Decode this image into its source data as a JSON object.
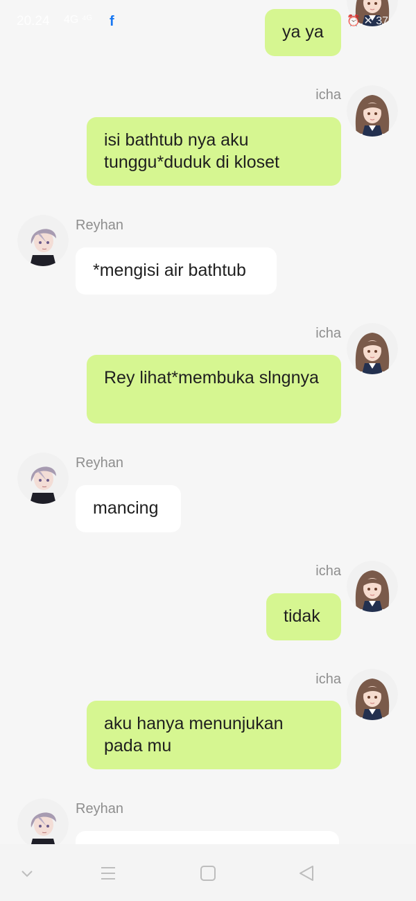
{
  "status_bar": {
    "time": "20.24",
    "signal": "4G ⁴ᴳ",
    "app_icon": "facebook-icon",
    "right": "⏰ ✕ 37"
  },
  "messages": [
    {
      "sender": "icha",
      "side": "right",
      "text": "ya ya"
    },
    {
      "sender": "icha",
      "side": "right",
      "text": "isi bathtub nya aku tunggu*duduk di kloset"
    },
    {
      "sender": "Reyhan",
      "side": "left",
      "text": "*mengisi air bathtub"
    },
    {
      "sender": "icha",
      "side": "right",
      "text": "Rey lihat*membuka slngnya"
    },
    {
      "sender": "Reyhan",
      "side": "left",
      "text": "mancing"
    },
    {
      "sender": "icha",
      "side": "right",
      "text": "tidak"
    },
    {
      "sender": "icha",
      "side": "right",
      "text": "aku hanya menunjukan pada mu"
    },
    {
      "sender": "Reyhan",
      "side": "left",
      "text": ""
    }
  ],
  "colors": {
    "sent_bubble": "#d6f691",
    "received_bubble": "#ffffff",
    "background": "#f6f6f6"
  },
  "nav": {
    "icons": [
      "chevron-down-icon",
      "menu-icon",
      "home-square-icon",
      "back-triangle-icon"
    ]
  }
}
